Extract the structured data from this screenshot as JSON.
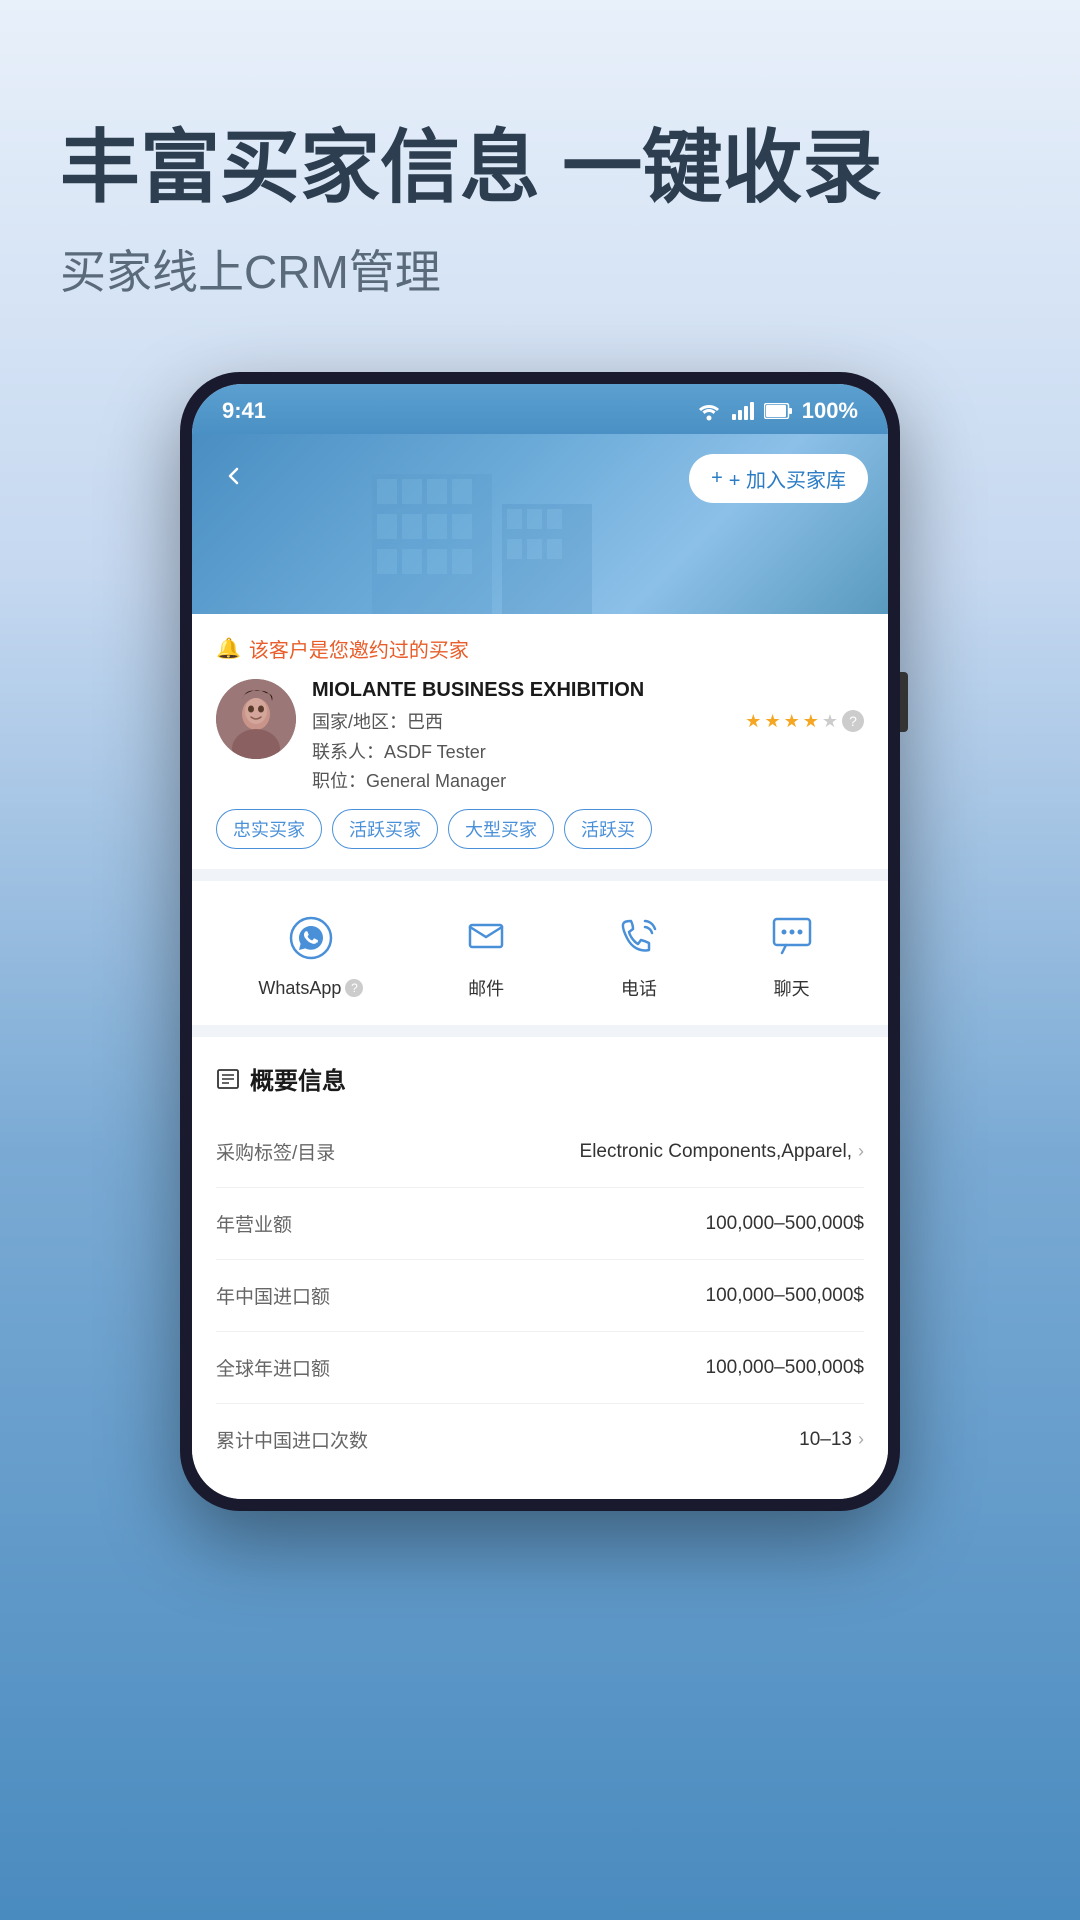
{
  "header": {
    "main_title": "丰富买家信息 一键收录",
    "sub_title": "买家线上CRM管理"
  },
  "phone": {
    "status_bar": {
      "time": "9:41",
      "battery": "100%"
    },
    "add_buyer_btn": "+ 加入买家库",
    "buyer_notice": "该客户是您邀约过的买家",
    "company": {
      "name": "MIOLANTE BUSINESS EXHIBITION",
      "country_label": "国家/地区：",
      "country": "巴西",
      "stars": 4,
      "total_stars": 5,
      "contact_label": "联系人：",
      "contact": "ASDF Tester",
      "position_label": "职位：",
      "position": "General Manager"
    },
    "tags": [
      "忠实买家",
      "活跃买家",
      "大型买家",
      "活跃买"
    ],
    "actions": [
      {
        "label": "WhatsApp",
        "has_help": true,
        "type": "whatsapp"
      },
      {
        "label": "邮件",
        "has_help": false,
        "type": "mail"
      },
      {
        "label": "电话",
        "has_help": false,
        "type": "phone"
      },
      {
        "label": "聊天",
        "has_help": false,
        "type": "chat"
      }
    ],
    "info_section": {
      "title": "概要信息",
      "rows": [
        {
          "label": "采购标签/目录",
          "value": "Electronic Components,Apparel,",
          "has_chevron": true
        },
        {
          "label": "年营业额",
          "value": "100,000–500,000$",
          "has_chevron": false
        },
        {
          "label": "年中国进口额",
          "value": "100,000–500,000$",
          "has_chevron": false
        },
        {
          "label": "全球年进口额",
          "value": "100,000–500,000$",
          "has_chevron": false
        },
        {
          "label": "累计中国进口次数",
          "value": "10–13",
          "has_chevron": true
        }
      ]
    }
  }
}
